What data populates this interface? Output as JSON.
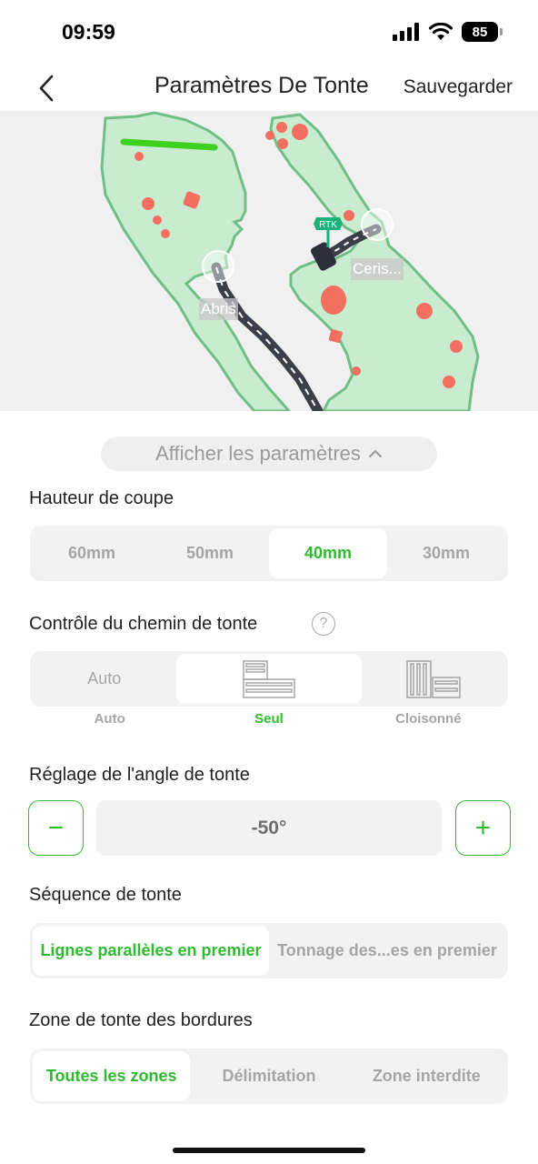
{
  "status_bar": {
    "time": "09:59",
    "battery": "85"
  },
  "header": {
    "title": "Paramètres De Tonte",
    "save_label": "Sauvegarder"
  },
  "map": {
    "labels": [
      "Abris",
      "Ceris..."
    ],
    "rtk_label": "RTK"
  },
  "settings_toggle": {
    "label": "Afficher les paramètres"
  },
  "cut_height": {
    "title": "Hauteur de coupe",
    "options": [
      "60mm",
      "50mm",
      "40mm",
      "30mm"
    ],
    "selected": "40mm"
  },
  "path_control": {
    "title": "Contrôle du chemin de tonte",
    "help": "?",
    "auto_label": "Auto",
    "options": [
      "Auto",
      "Seul",
      "Cloisonné"
    ],
    "selected": "Seul"
  },
  "angle": {
    "title": "Réglage de l'angle de tonte",
    "value": "-50°",
    "minus": "−",
    "plus": "+"
  },
  "sequence": {
    "title": "Séquence de tonte",
    "options": [
      "Lignes parallèles en premier",
      "Tonnage des...es en premier"
    ],
    "selected": "Lignes parallèles en premier"
  },
  "border_zone": {
    "title": "Zone de tonte des bordures",
    "options": [
      "Toutes les zones",
      "Délimitation",
      "Zone interdite"
    ],
    "selected": "Toutes les zones"
  },
  "colors": {
    "accent": "#2fba2f",
    "lawn": "#c9ebcf",
    "lawn_border": "#6fbf86",
    "obstacle": "#f26f62",
    "path": "#3a3f48"
  }
}
